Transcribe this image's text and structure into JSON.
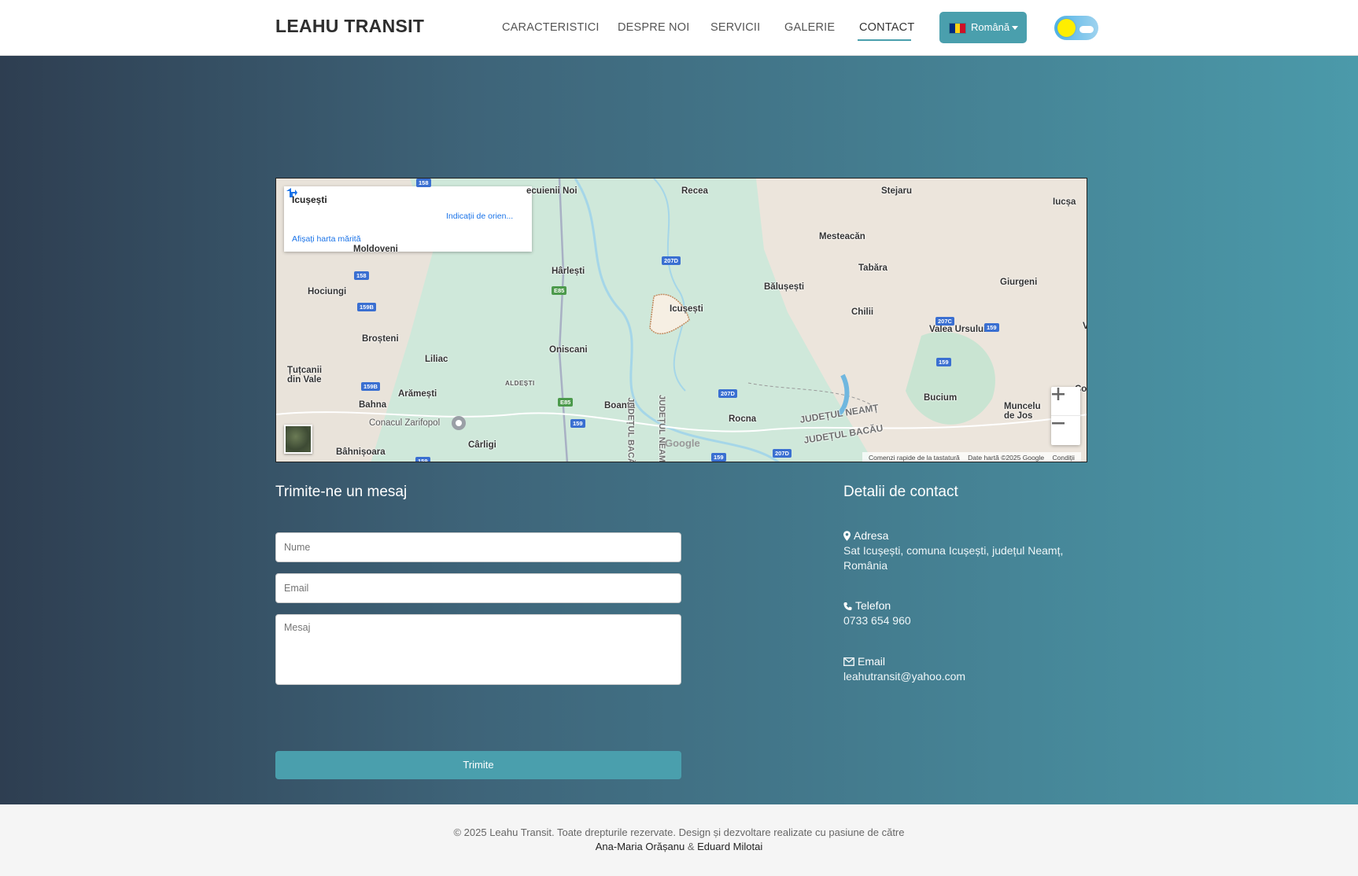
{
  "brand": "LEAHU TRANSIT",
  "nav": {
    "items": [
      "CARACTERISTICI",
      "DESPRE NOI",
      "SERVICII",
      "GALERIE",
      "CONTACT"
    ],
    "active": "CONTACT",
    "language": "Română"
  },
  "colors": {
    "accent": "#4a9fad",
    "gradient_start": "#2e3e51",
    "gradient_end": "#4b9aaa"
  },
  "map": {
    "place_title": "Icușești",
    "directions_label": "Indicații de orien...",
    "larger_map_link": "Afișați harta mărită",
    "labels": {
      "top_left_partial": "ecuienii Noi",
      "recea": "Recea",
      "stejaru": "Stejaru",
      "iucsa": "Iucșa",
      "mesteacan": "Mesteacăn",
      "moldoveni": "Moldoveni",
      "harlesti": "Hârlești",
      "tabara": "Tabăra",
      "hociungi": "Hociungi",
      "balusesti": "Bălușești",
      "giurgeni": "Giurgeni",
      "icusesti": "Icușești",
      "chilii": "Chilii",
      "valea_ursului": "Valea Ursului",
      "brosteni": "Broșteni",
      "oniscani": "Oniscani",
      "liliac": "Liliac",
      "tutcanii_1": "Țuțcanii",
      "tutcanii_2": "din Vale",
      "aldesti": "ALDEȘTI",
      "aramesti": "Arămești",
      "bahna": "Bahna",
      "boanta": "Boanța",
      "bucium": "Bucium",
      "muncelu_1": "Muncelu",
      "muncelu_2": "de Jos",
      "conacul": "Conacul Zarifopol",
      "rocna": "Rocna",
      "judetul_neamt": "JUDEȚUL NEAMȚ",
      "judetul_bacau": "JUDEȚUL BACĂU",
      "judetul_bacau_vertical": "JUDEȚUL BACĂ",
      "judetul_neamt_vertical": "JUDEȚUL NEAM",
      "carligi": "Cârligi",
      "bahnisoara": "Bâhnișoara",
      "edge_v": "V",
      "edge_con": "Con"
    },
    "shields": {
      "r158a": "158",
      "r158b": "158",
      "r159b_a": "159B",
      "r159b_b": "159B",
      "e85a": "E85",
      "e85b": "E85",
      "r159a": "159",
      "r159b": "159",
      "r159c": "159",
      "r159d": "159",
      "r159e": "159",
      "r207d_a": "207D",
      "r207d_b": "207D",
      "r207d_c": "207D",
      "r207c": "207C"
    },
    "google_logo": "Google",
    "footer": {
      "keyboard": "Comenzi rapide de la tastatură",
      "data": "Date hartă ©2025 Google",
      "terms": "Condiții"
    },
    "zoom_in_icon": "plus-icon",
    "zoom_out_icon": "minus-icon"
  },
  "form": {
    "title": "Trimite-ne un mesaj",
    "name_placeholder": "Nume",
    "email_placeholder": "Email",
    "message_placeholder": "Mesaj",
    "submit_label": "Trimite"
  },
  "contact": {
    "title": "Detalii de contact",
    "address_label": "Adresa",
    "address_line1": "Sat Icușești, comuna Icușești, județul Neamț,",
    "address_line2": "România",
    "phone_label": "Telefon",
    "phone": "0733 654 960",
    "email_label": "Email",
    "email": "leahutransit@yahoo.com"
  },
  "footer": {
    "text": "© 2025 Leahu Transit. Toate drepturile rezervate. Design și dezvoltare realizate cu pasiune de către",
    "author1": "Ana-Maria Orășanu",
    "separator": "&",
    "author2": "Eduard Milotai"
  }
}
